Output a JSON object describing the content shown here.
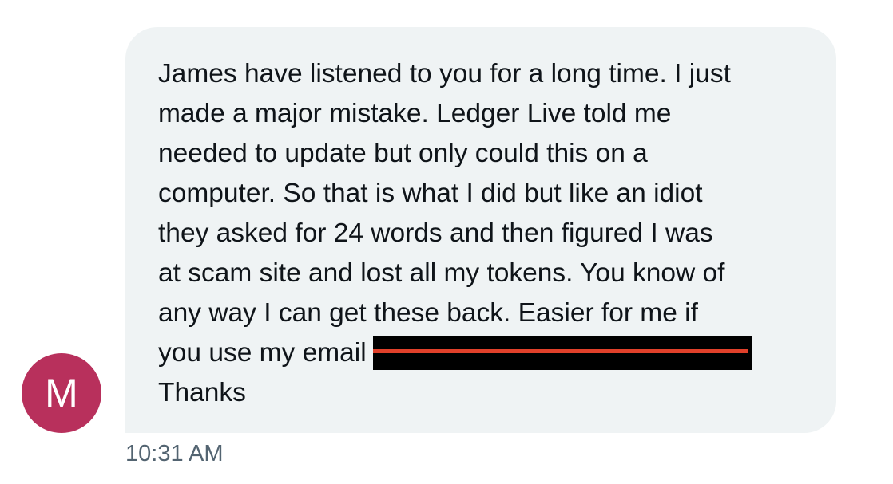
{
  "colors": {
    "bubble_bg": "#eff3f4",
    "avatar_bg": "#b8305c",
    "text": "#0f1419",
    "timestamp": "#536471",
    "redaction_stripe": "#e0402a"
  },
  "sender": {
    "avatar_initial": "M",
    "avatar_icon": "letter-avatar"
  },
  "message": {
    "lines": [
      "James have listened to you for a long time. I just",
      "made a major mistake. Ledger Live told me",
      "needed to update but only could this on a",
      "computer. So that is what I did but like an idiot",
      "they asked for 24 words and then figured I was",
      "at scam site and lost all my tokens. You know of",
      "any way I can get these back. Easier for me if",
      "you use my email",
      "Thanks"
    ],
    "redacted": true
  },
  "timestamp": "10:31 AM"
}
